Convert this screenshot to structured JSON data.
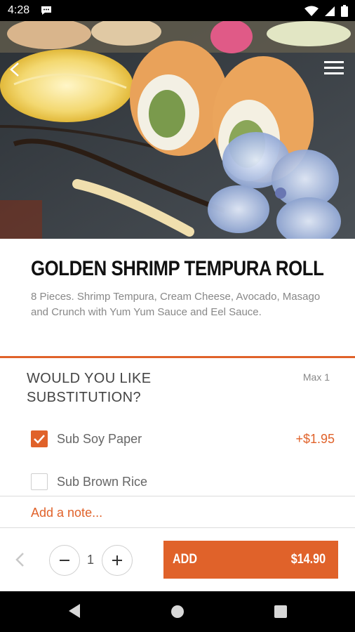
{
  "status_bar": {
    "time": "4:28",
    "icons": [
      "message-icon",
      "wifi-icon",
      "signal-icon",
      "battery-icon"
    ]
  },
  "hero": {
    "image_alt": "Golden shrimp tempura roll sushi on slate with a blue flower",
    "icons": [
      "back-arrow-icon",
      "hamburger-menu-icon"
    ]
  },
  "product": {
    "title": "GOLDEN SHRIMP TEMPURA ROLL",
    "description": "8 Pieces. Shrimp Tempura, Cream Cheese, Avocado, Masago and Crunch with Yum Yum Sauce and Eel Sauce."
  },
  "substitution": {
    "heading": "WOULD YOU LIKE SUBSTITUTION?",
    "max_label": "Max 1",
    "options": [
      {
        "label": "Sub Soy Paper",
        "price": "+$1.95",
        "checked": true
      },
      {
        "label": "Sub Brown Rice",
        "price": "",
        "checked": false
      }
    ]
  },
  "note": {
    "placeholder": "Add a note..."
  },
  "action_bar": {
    "quantity": "1",
    "add_label": "ADD",
    "add_price": "$14.90"
  },
  "colors": {
    "accent": "#e0622a",
    "text_dark": "#111111",
    "text_muted": "#888888"
  }
}
